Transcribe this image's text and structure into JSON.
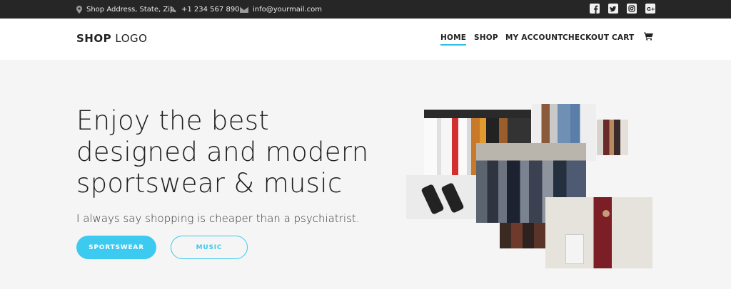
{
  "topbar": {
    "address": "Shop Address, State, Zip",
    "phone": "+1 234 567 890",
    "email": "info@yourmail.com",
    "social": [
      "facebook",
      "twitter",
      "instagram",
      "google-plus"
    ]
  },
  "header": {
    "logo_bold": "SHOP",
    "logo_light": "LOGO",
    "nav": [
      "HOME",
      "SHOP",
      "MY ACCOUNT",
      "CHECKOUT",
      "CART"
    ],
    "active_nav": "HOME"
  },
  "hero": {
    "headline_lines": [
      "Enjoy the best",
      "designed and modern",
      "sportswear & music"
    ],
    "subline": "I always say shopping is cheaper than a psychiatrist.",
    "primary_button": "SPORTSWEAR",
    "secondary_button": "MUSIC"
  },
  "colors": {
    "accent": "#3ccaf0",
    "topbar_bg": "#262626",
    "hero_bg": "#f5f5f5"
  }
}
